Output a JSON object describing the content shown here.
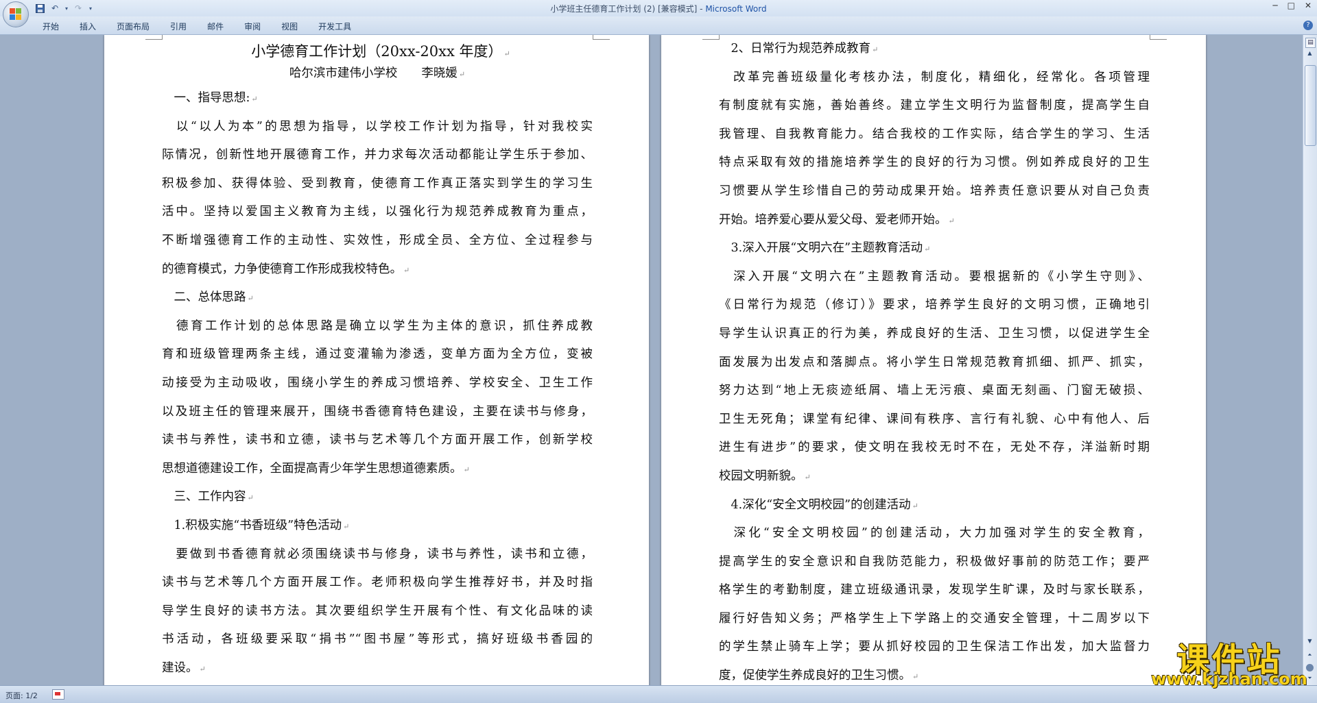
{
  "window": {
    "title_doc": "小学班主任德育工作计划 (2) [兼容模式] - ",
    "title_app": "Microsoft Word",
    "controls": [
      "─",
      "□",
      "✕"
    ]
  },
  "ribbon": {
    "tabs": [
      "开始",
      "插入",
      "页面布局",
      "引用",
      "邮件",
      "审阅",
      "视图",
      "开发工具"
    ]
  },
  "help": "?",
  "pilcrow": "↵",
  "left_page": {
    "title": "小学德育工作计划（20xx-20xx 年度）",
    "subtitle": "哈尔滨市建伟小学校　　李晓媛",
    "lines": [
      "　一、指导思想:",
      "　以“以人为本”的思想为指导，以学校工作计划为指导，针对我校实",
      "际情况，创新性地开展德育工作，并力求每次活动都能让学生乐于参加、",
      "积极参加、获得体验、受到教育，使德育工作真正落实到学生的学习生",
      "活中。坚持以爱国主义教育为主线，以强化行为规范养成教育为重点，",
      "不断增强德育工作的主动性、实效性，形成全员、全方位、全过程参与",
      "的德育模式，力争使德育工作形成我校特色。",
      "　二、总体思路",
      "　德育工作计划的总体思路是确立以学生为主体的意识，抓住养成教",
      "育和班级管理两条主线，通过变灌输为渗透，变单方面为全方位，变被",
      "动接受为主动吸收，围绕小学生的养成习惯培养、学校安全、卫生工作",
      "以及班主任的管理来展开，围绕书香德育特色建设，主要在读书与修身，",
      "读书与养性，读书和立德，读书与艺术等几个方面开展工作，创新学校",
      "思想道德建设工作，全面提高青少年学生思想道德素质。",
      "　三、工作内容",
      "　1.积极实施“书香班级”特色活动",
      "　要做到书香德育就必须围绕读书与修身，读书与养性，读书和立德，",
      "读书与艺术等几个方面开展工作。老师积极向学生推荐好书，并及时指",
      "导学生良好的读书方法。其次要组织学生开展有个性、有文化品味的读",
      "书活动，各班级要采取“捐书”“图书屋”等形式，搞好班级书香园的",
      "建设。"
    ]
  },
  "right_page": {
    "lines": [
      "　2、日常行为规范养成教育",
      "　改革完善班级量化考核办法，制度化，精细化，经常化。各项管理",
      "有制度就有实施，善始善终。建立学生文明行为监督制度，提高学生自",
      "我管理、自我教育能力。结合我校的工作实际，结合学生的学习、生活",
      "特点采取有效的措施培养学生的良好的行为习惯。例如养成良好的卫生",
      "习惯要从学生珍惜自己的劳动成果开始。培养责任意识要从对自己负责",
      "开始。培养爱心要从爱父母、爱老师开始。",
      "　3.深入开展“文明六在”主题教育活动",
      "　深入开展“文明六在”主题教育活动。要根据新的《小学生守则》、",
      "《日常行为规范（修订）》要求，培养学生良好的文明习惯，正确地引",
      "导学生认识真正的行为美，养成良好的生活、卫生习惯，以促进学生全",
      "面发展为出发点和落脚点。将小学生日常规范教育抓细、抓严、抓实，",
      "努力达到“地上无痰迹纸屑、墙上无污痕、桌面无刻画、门窗无破损、",
      "卫生无死角；课堂有纪律、课间有秩序、言行有礼貌、心中有他人、后",
      "进生有进步”的要求，使文明在我校无时不在，无处不存，洋溢新时期",
      "校园文明新貌。",
      "　4.深化“安全文明校园”的创建活动",
      "　深化“安全文明校园”的创建活动，大力加强对学生的安全教育，",
      "提高学生的安全意识和自我防范能力，积极做好事前的防范工作；要严",
      "格学生的考勤制度，建立班级通讯录，发现学生旷课，及时与家长联系，",
      "履行好告知义务；严格学生上下学路上的交通安全管理，十二周岁以下",
      "的学生禁止骑车上学；要从抓好校园的卫生保洁工作出发，加大监督力",
      "度，促使学生养成良好的卫生习惯。"
    ]
  },
  "status": {
    "page_info": "页面: 1/2"
  },
  "watermark": {
    "text": "课件站",
    "url": "www.kjzhan.com"
  },
  "colors": {
    "doc_background": "#9eafc6",
    "ribbon": "#dfe9f5",
    "title_app": "#1f53a6",
    "watermark": "#f7d21a"
  }
}
